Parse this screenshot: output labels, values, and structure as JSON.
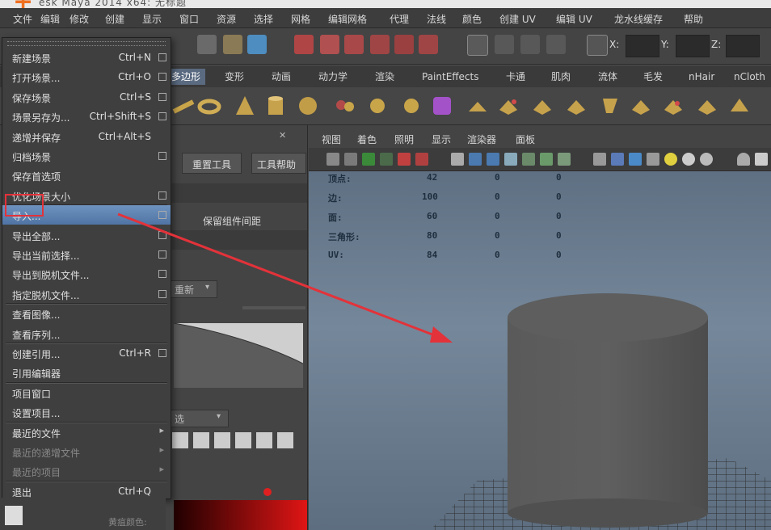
{
  "window": {
    "title": "esk Maya 2014 x64: 无标题"
  },
  "menubar": [
    "文件",
    "编辑",
    "修改",
    "创建",
    "显示",
    "窗口",
    "资源",
    "选择",
    "网格",
    "编辑网格",
    "代理",
    "法线",
    "颜色",
    "创建 UV",
    "编辑 UV",
    "龙水线缓存",
    "帮助"
  ],
  "statusline": {
    "x_label": "X:",
    "y_label": "Y:",
    "z_label": "Z:"
  },
  "shelf_tabs": [
    "多边形",
    "变形",
    "动画",
    "动力学",
    "渲染",
    "PaintEffects",
    "卡通",
    "肌肉",
    "流体",
    "毛发",
    "nHair",
    "nCloth"
  ],
  "tool_panel": {
    "btn_reset": "重置工具",
    "btn_help": "工具帮助",
    "option": "保留组件间距",
    "dropdown": "重新",
    "dropdown2": "选"
  },
  "viewport": {
    "menu": [
      "视图",
      "着色",
      "照明",
      "显示",
      "渲染器",
      "面板"
    ],
    "hud": [
      {
        "label": "顶点:",
        "v1": "42",
        "v2": "0",
        "v3": "0"
      },
      {
        "label": "边:",
        "v1": "100",
        "v2": "0",
        "v3": "0"
      },
      {
        "label": "面:",
        "v1": "60",
        "v2": "0",
        "v3": "0"
      },
      {
        "label": "三角形:",
        "v1": "80",
        "v2": "0",
        "v3": "0"
      },
      {
        "label": "UV:",
        "v1": "84",
        "v2": "0",
        "v3": "0"
      }
    ]
  },
  "file_menu": {
    "items": [
      {
        "label": "新建场景",
        "shortcut": "Ctrl+N",
        "option": true
      },
      {
        "label": "打开场景...",
        "shortcut": "Ctrl+O",
        "option": true
      },
      {
        "label": "保存场景",
        "shortcut": "Ctrl+S",
        "option": true
      },
      {
        "label": "场景另存为...",
        "shortcut": "Ctrl+Shift+S",
        "option": true
      },
      {
        "label": "递增并保存",
        "shortcut": "Ctrl+Alt+S",
        "option": false
      },
      {
        "label": "归档场景",
        "shortcut": "",
        "option": true
      },
      {
        "label": "保存首选项",
        "shortcut": "",
        "option": false
      },
      {
        "label": "优化场景大小",
        "shortcut": "",
        "option": true
      },
      {
        "label": "导入...",
        "shortcut": "",
        "option": true,
        "highlight": true
      },
      {
        "label": "导出全部...",
        "shortcut": "",
        "option": true
      },
      {
        "label": "导出当前选择...",
        "shortcut": "",
        "option": true
      },
      {
        "label": "导出到脱机文件...",
        "shortcut": "",
        "option": true
      },
      {
        "label": "指定脱机文件...",
        "shortcut": "",
        "option": true
      },
      {
        "label": "查看图像...",
        "shortcut": "",
        "option": false
      },
      {
        "label": "查看序列...",
        "shortcut": "",
        "option": false
      },
      {
        "label": "创建引用...",
        "shortcut": "Ctrl+R",
        "option": true
      },
      {
        "label": "引用编辑器",
        "shortcut": "",
        "option": false
      },
      {
        "label": "项目窗口",
        "shortcut": "",
        "option": false
      },
      {
        "label": "设置项目...",
        "shortcut": "",
        "option": false
      },
      {
        "label": "最近的文件",
        "shortcut": "",
        "submenu": true
      },
      {
        "label": "最近的递增文件",
        "shortcut": "",
        "submenu": true,
        "disabled": true
      },
      {
        "label": "最近的项目",
        "shortcut": "",
        "submenu": true,
        "disabled": true
      },
      {
        "label": "退出",
        "shortcut": "Ctrl+Q",
        "option": false
      }
    ]
  },
  "bottom": {
    "label": "黄疽颜色:"
  },
  "colors": {
    "highlight": "#5d82b3",
    "annotation": "#e3323a",
    "viewport_bg": "#6b7d90"
  }
}
